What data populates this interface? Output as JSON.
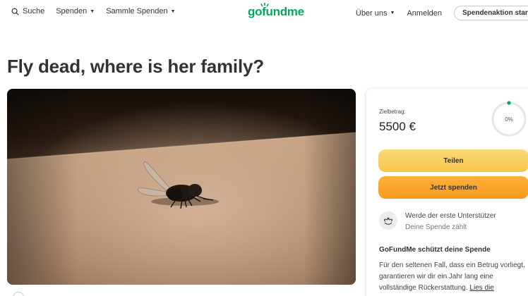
{
  "header": {
    "search_label": "Suche",
    "donate_menu_label": "Spenden",
    "collect_menu_label": "Sammle Spenden",
    "logo_text": "gofundme",
    "about_label": "Über uns",
    "login_label": "Anmelden",
    "start_button_label": "Spendenaktion starten",
    "brand_color": "#02a95c"
  },
  "campaign": {
    "title": "Fly dead, where is her family?",
    "image_alt_icon": "fly-photo"
  },
  "donation_card": {
    "goal_label": "Zielbetrag:",
    "goal_value": "5500 €",
    "progress_text": "0%",
    "progress_fraction": 0,
    "share_button_label": "Teilen",
    "donate_button_label": "Jetzt spenden",
    "share_button_color": "#f5c649",
    "donate_button_color": "#f79b1f",
    "supporter_icon": "helping-hands-icon",
    "supporter_title": "Werde der erste Unterstützer",
    "supporter_subtitle": "Deine Spende zählt",
    "protect_title": "GoFundMe schützt deine Spende",
    "protect_text": "Für den seltenen Fall, dass ein Betrug vorliegt, garantieren wir dir ein Jahr lang eine vollständige Rückerstattung.",
    "protect_link": "Lies die"
  }
}
